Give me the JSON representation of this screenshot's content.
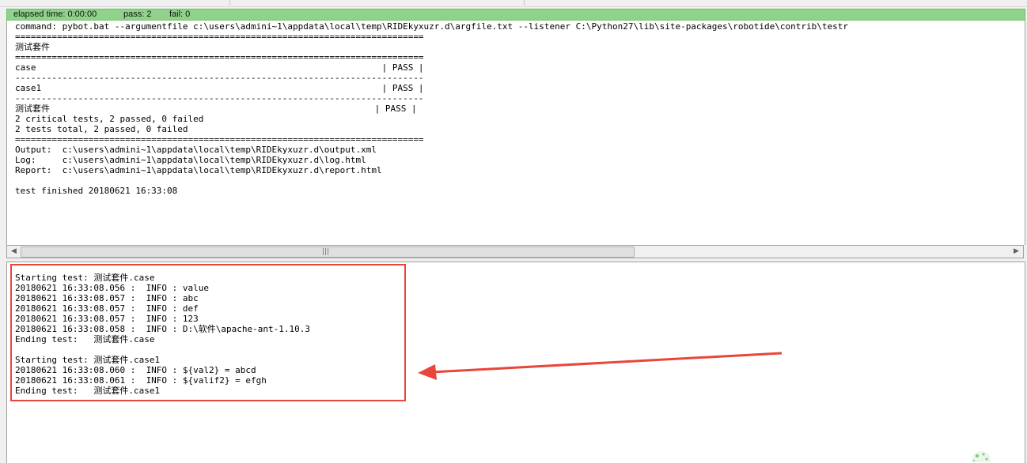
{
  "status_bar": {
    "elapsed": "elapsed time: 0:00:00",
    "pass": "pass: 2",
    "fail": "fail: 0",
    "color": "#8fd38a"
  },
  "output_lines": [
    "command: pybot.bat --argumentfile c:\\users\\admini~1\\appdata\\local\\temp\\RIDEkyxuzr.d\\argfile.txt --listener C:\\Python27\\lib\\site-packages\\robotide\\contrib\\testr",
    "==============================================================================",
    "测试套件",
    "==============================================================================",
    "case                                                                  | PASS |",
    "------------------------------------------------------------------------------",
    "case1                                                                 | PASS |",
    "------------------------------------------------------------------------------",
    "测试套件                                                              | PASS |",
    "2 critical tests, 2 passed, 0 failed",
    "2 tests total, 2 passed, 0 failed",
    "==============================================================================",
    "Output:  c:\\users\\admini~1\\appdata\\local\\temp\\RIDEkyxuzr.d\\output.xml",
    "Log:     c:\\users\\admini~1\\appdata\\local\\temp\\RIDEkyxuzr.d\\log.html",
    "Report:  c:\\users\\admini~1\\appdata\\local\\temp\\RIDEkyxuzr.d\\report.html",
    "",
    "test finished 20180621 16:33:08"
  ],
  "scrollbar": {
    "left_arrow": "◀",
    "right_arrow": "▶",
    "grip": "|||"
  },
  "log_lines": [
    "Starting test: 测试套件.case",
    "20180621 16:33:08.056 :  INFO : value",
    "20180621 16:33:08.057 :  INFO : abc",
    "20180621 16:33:08.057 :  INFO : def",
    "20180621 16:33:08.057 :  INFO : 123",
    "20180621 16:33:08.058 :  INFO : D:\\软件\\apache-ant-1.10.3",
    "Ending test:   测试套件.case",
    "",
    "Starting test: 测试套件.case1",
    "20180621 16:33:08.060 :  INFO : ${val2} = abcd",
    "20180621 16:33:08.061 :  INFO : ${valif2} = efgh",
    "Ending test:   测试套件.case1"
  ],
  "annotation": {
    "box_color": "#e8463a",
    "arrow_color": "#e8463a"
  }
}
